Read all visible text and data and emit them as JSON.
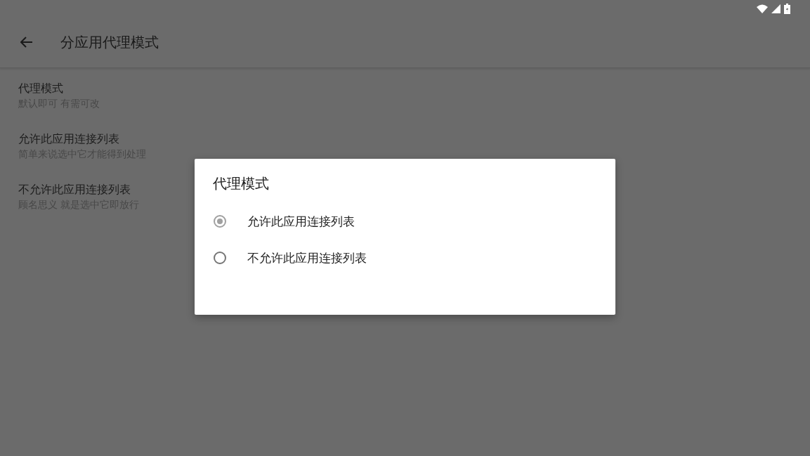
{
  "toolbar": {
    "title": "分应用代理模式"
  },
  "settings": [
    {
      "title": "代理模式",
      "summary": "默认即可 有需可改"
    },
    {
      "title": "允许此应用连接列表",
      "summary": "简单来说选中它才能得到处理"
    },
    {
      "title": "不允许此应用连接列表",
      "summary": "顾名思义 就是选中它即放行"
    }
  ],
  "dialog": {
    "title": "代理模式",
    "options": [
      {
        "label": "允许此应用连接列表",
        "selected": true
      },
      {
        "label": "不允许此应用连接列表",
        "selected": false
      }
    ]
  }
}
